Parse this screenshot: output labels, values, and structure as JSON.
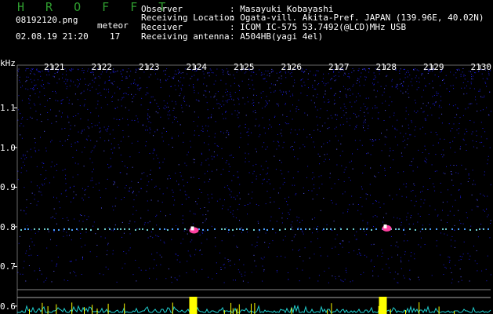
{
  "header": {
    "title": "H R O F F T",
    "filename": "08192120.png",
    "datetime": "02.08.19 21:20",
    "meteor_label": "meteor",
    "meteor_count": "17",
    "observer_label": "Observer",
    "observer": ": Masayuki Kobayashi",
    "location_label": "Receiving Location",
    "location": ": Ogata-vill. Akita-Pref. JAPAN (139.96E, 40.02N)",
    "receiver_label": "Receiver",
    "receiver": ": ICOM IC-575 53.7492(@LCD)MHz USB",
    "antenna_label": "Receiving antenna",
    "antenna": ": A504HB(yagi 4el)"
  },
  "colors": {
    "title": "#2f9d2f",
    "noise": "#1a1ad8",
    "signal": "#ffff00",
    "baseline": "#20d0d0",
    "grid": "#6a6a6a"
  },
  "chart_data": {
    "type": "heatmap",
    "yunit": "kHz",
    "x_ticks": [
      "2121",
      "2122",
      "2123",
      "2124",
      "2125",
      "2126",
      "2127",
      "2128",
      "2129",
      "2130"
    ],
    "y_ticks": [
      "1.1",
      "1.0",
      "0.9",
      "0.8",
      "0.7",
      "0.6"
    ],
    "ylim": [
      0.58,
      1.2
    ],
    "carrier_khz": 0.8,
    "meteor_echoes": [
      {
        "time": "2124",
        "freq_khz": 0.795
      },
      {
        "time": "2128",
        "freq_khz": 0.8
      }
    ]
  }
}
